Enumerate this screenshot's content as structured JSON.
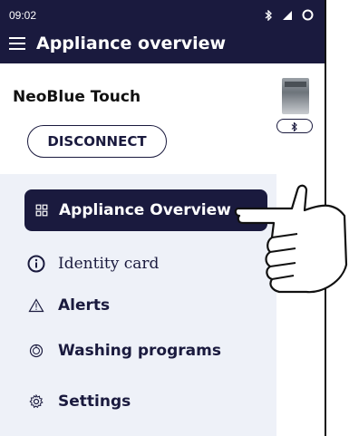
{
  "status_bar": {
    "time": "09:02",
    "icons": [
      "bluetooth-icon",
      "signal-icon",
      "battery-icon"
    ]
  },
  "app_bar": {
    "menu_icon": "hamburger-menu-icon",
    "title": "Appliance overview"
  },
  "drawer": {
    "device_name": "NeoBlue Touch",
    "disconnect_label": "DISCONNECT",
    "items": [
      {
        "label": "Appliance Overview",
        "icon": "grid-icon",
        "active": true
      },
      {
        "label": "Identity card",
        "icon": "info-icon",
        "active": false
      },
      {
        "label": "Alerts",
        "icon": "warning-icon",
        "active": false
      },
      {
        "label": "Washing programs",
        "icon": "program-dial-icon",
        "active": false
      },
      {
        "label": "Settings",
        "icon": "gear-icon",
        "active": false
      }
    ]
  },
  "background_card": {
    "image": "dishwasher-image",
    "connection_icon": "bluetooth-icon"
  },
  "gesture": {
    "icon": "pointing-hand-icon"
  },
  "colors": {
    "primary_navy": "#1a1a3e",
    "menu_background": "#eef1f8",
    "white": "#ffffff"
  }
}
